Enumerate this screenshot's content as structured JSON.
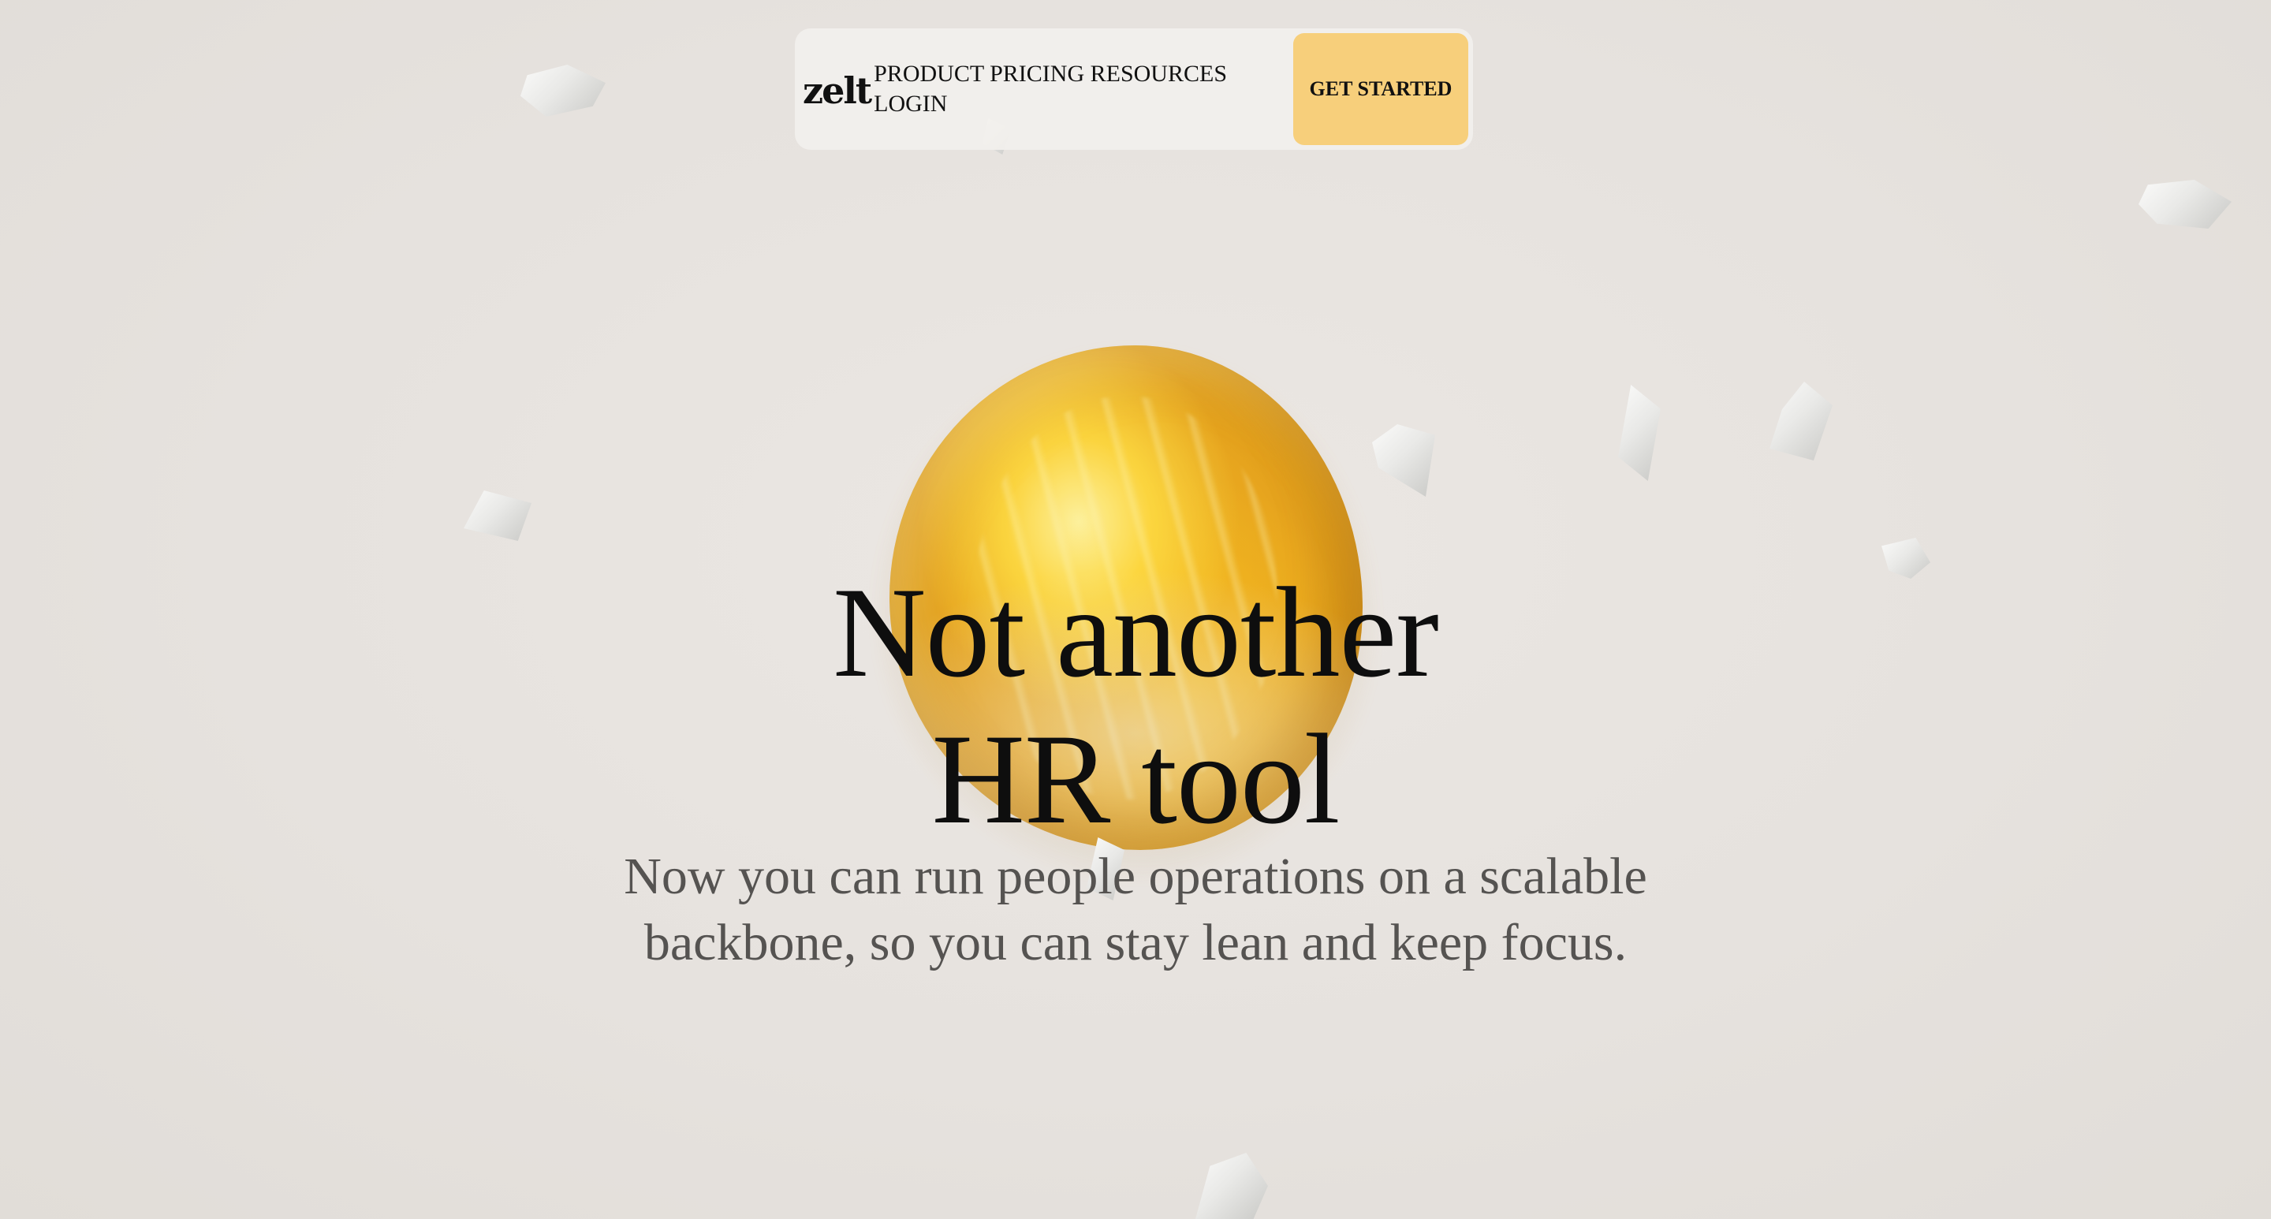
{
  "nav": {
    "logo": "zelt",
    "links": {
      "product": "PRODUCT",
      "pricing": "PRICING",
      "resources": "RESOURCES",
      "login": "LOGIN"
    },
    "cta_label": "GET STARTED"
  },
  "hero": {
    "headline_line1": "Not another",
    "headline_line2": "HR tool",
    "subtitle": "Now you can run people operations on a scalable backbone, so you can stay lean and keep focus."
  },
  "colors": {
    "background": "#e6e2de",
    "cta_background": "#f7cf7b",
    "orb": "#e7a214",
    "subtitle_text": "#555351"
  }
}
